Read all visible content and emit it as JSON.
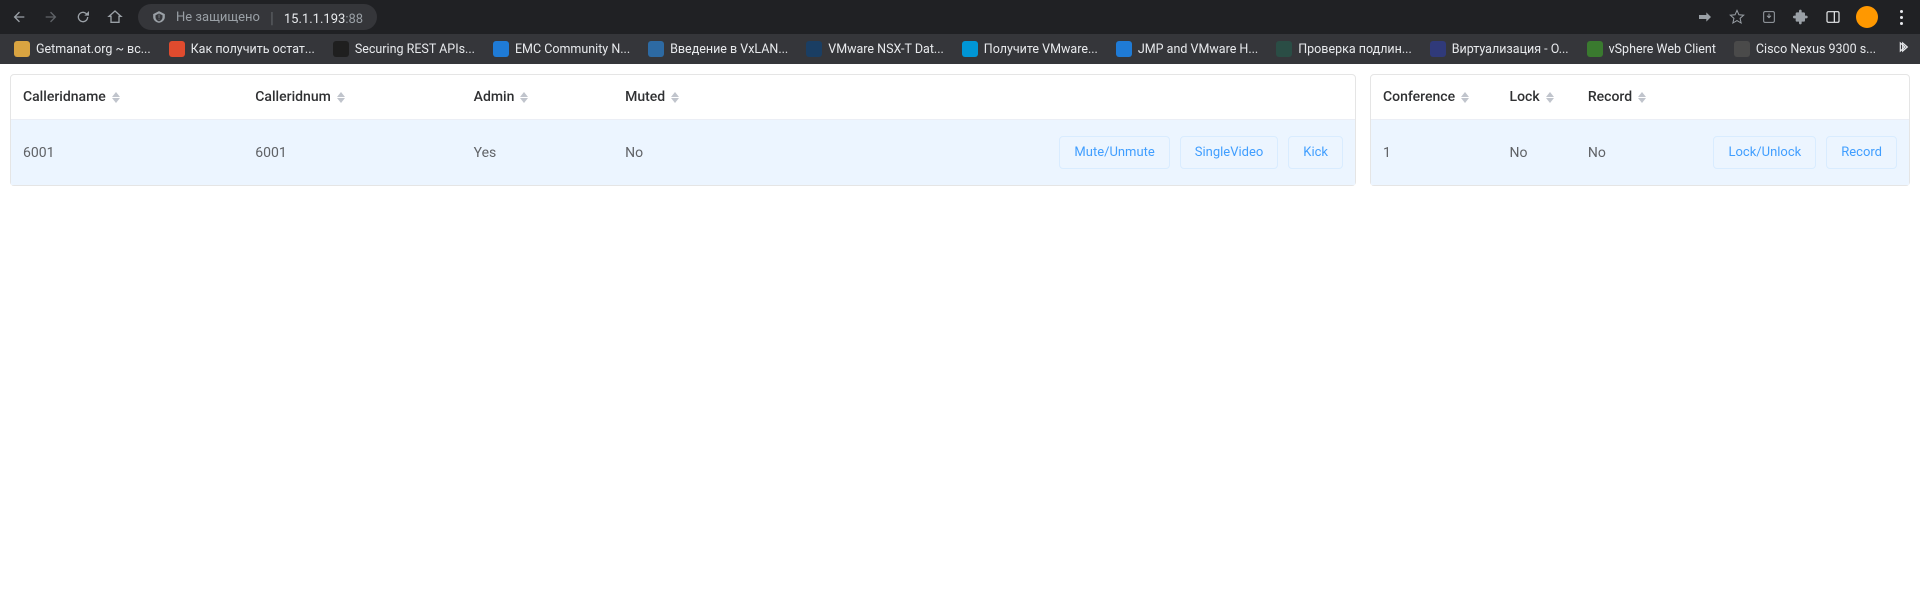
{
  "browser": {
    "security_label": "Не защищено",
    "url_host": "15.1.1.193",
    "url_port": ":88"
  },
  "bookmarks": [
    {
      "label": "Getmanat.org ~ вс...",
      "color": "#d9a441"
    },
    {
      "label": "Как получить остат...",
      "color": "#e04b2e"
    },
    {
      "label": "Securing REST APIs...",
      "color": "#1f1f1f"
    },
    {
      "label": "EMC Community N...",
      "color": "#1f7bd6"
    },
    {
      "label": "Введение в VxLAN...",
      "color": "#2d6aa3"
    },
    {
      "label": "VMware NSX-T Dat...",
      "color": "#1a3e63"
    },
    {
      "label": "Получите VMware...",
      "color": "#0096d6"
    },
    {
      "label": "JMP and VMware H...",
      "color": "#1f7bd6"
    },
    {
      "label": "Проверка подлин...",
      "color": "#2a4d45"
    },
    {
      "label": "Виртуализация - O...",
      "color": "#303a7a"
    },
    {
      "label": "vSphere Web Client",
      "color": "#3a7a2f"
    },
    {
      "label": "Cisco Nexus 9300 s...",
      "color": "#4a4a4a"
    }
  ],
  "left_table": {
    "headers": {
      "calleridname": "Calleridname",
      "calleridnum": "Calleridnum",
      "admin": "Admin",
      "muted": "Muted"
    },
    "row": {
      "calleridname": "6001",
      "calleridnum": "6001",
      "admin": "Yes",
      "muted": "No"
    },
    "actions": {
      "mute": "Mute/Unmute",
      "singlevideo": "SingleVideo",
      "kick": "Kick"
    }
  },
  "right_table": {
    "headers": {
      "conference": "Conference",
      "lock": "Lock",
      "record": "Record"
    },
    "row": {
      "conference": "1",
      "lock": "No",
      "record": "No"
    },
    "actions": {
      "lockunlock": "Lock/Unlock",
      "record": "Record"
    }
  }
}
